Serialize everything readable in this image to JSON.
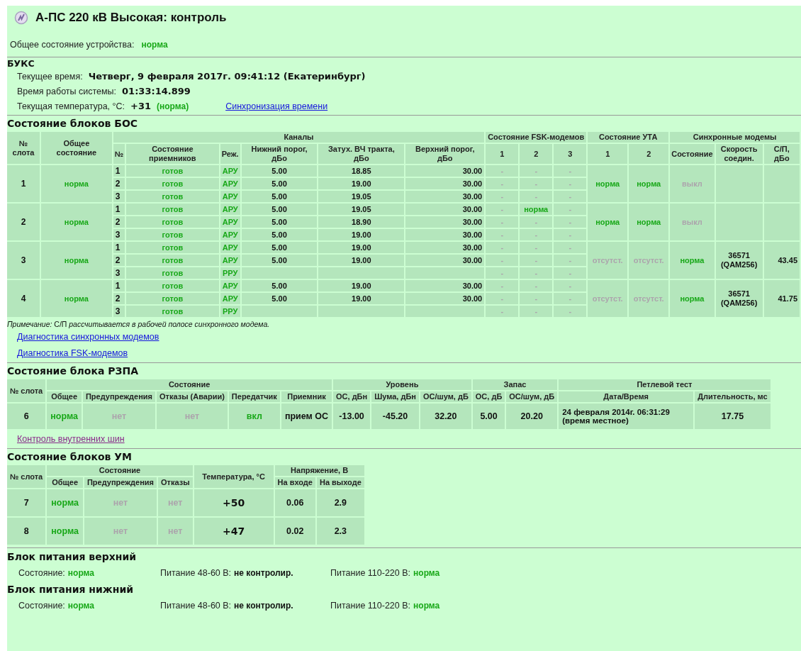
{
  "title": "А-ПС 220 кВ Высокая: контроль",
  "device_status": {
    "label": "Общее состояние устройства:",
    "value": {
      "text": "норма",
      "kind": "ok"
    }
  },
  "buks": {
    "heading": "БУКС",
    "fields": [
      {
        "label": "Текущее время:",
        "value": "Четверг, 9 февраля 2017г. 09:41:12 (Екатеринбург)"
      },
      {
        "label": "Время работы системы:",
        "value": "01:33:14.899"
      },
      {
        "label": "Текущая температура, °C:",
        "value": "+31",
        "note": {
          "text": "(норма)",
          "kind": "ok"
        },
        "link": "Синхронизация времени"
      }
    ]
  },
  "bos": {
    "heading": "Состояние блоков БОС",
    "column_groups": [
      {
        "label": "№ слота"
      },
      {
        "label": "Общее состояние"
      },
      {
        "label": "Каналы",
        "children": [
          "№",
          "Состояние приемников",
          "Реж.",
          "Нижний порог, дБо",
          "Затух. ВЧ тракта, дБо",
          "Верхний порог, дБо"
        ]
      },
      {
        "label": "Состояние FSK-модемов",
        "children": [
          "1",
          "2",
          "3"
        ]
      },
      {
        "label": "Состояние УТА",
        "children": [
          "1",
          "2"
        ]
      },
      {
        "label": "Синхронные модемы",
        "children": [
          "Состояние",
          "Скорость соедин.",
          "С/П, дБо"
        ]
      }
    ],
    "slots": [
      {
        "slot": "1",
        "status": {
          "text": "норма",
          "kind": "ok"
        },
        "channels": [
          {
            "number": "1",
            "receiver": {
              "text": "готов",
              "kind": "ok"
            },
            "mode": {
              "text": "АРУ",
              "kind": "ok"
            },
            "low": "5.00",
            "attenuation": "18.85",
            "high": "30.00",
            "fsk": [
              {
                "text": "-",
                "kind": "off"
              },
              {
                "text": "-",
                "kind": "off"
              },
              {
                "text": "-",
                "kind": "off"
              }
            ]
          },
          {
            "number": "2",
            "receiver": {
              "text": "готов",
              "kind": "ok"
            },
            "mode": {
              "text": "АРУ",
              "kind": "ok"
            },
            "low": "5.00",
            "attenuation": "19.00",
            "high": "30.00",
            "fsk": [
              {
                "text": "-",
                "kind": "off"
              },
              {
                "text": "-",
                "kind": "off"
              },
              {
                "text": "-",
                "kind": "off"
              }
            ]
          },
          {
            "number": "3",
            "receiver": {
              "text": "готов",
              "kind": "ok"
            },
            "mode": {
              "text": "АРУ",
              "kind": "ok"
            },
            "low": "5.00",
            "attenuation": "19.05",
            "high": "30.00",
            "fsk": [
              {
                "text": "-",
                "kind": "off"
              },
              {
                "text": "-",
                "kind": "off"
              },
              {
                "text": "-",
                "kind": "off"
              }
            ]
          }
        ],
        "uta": [
          {
            "text": "норма",
            "kind": "ok"
          },
          {
            "text": "норма",
            "kind": "ok"
          }
        ],
        "sync_state": {
          "text": "выкл",
          "kind": "off"
        }
      },
      {
        "slot": "2",
        "status": {
          "text": "норма",
          "kind": "ok"
        },
        "channels": [
          {
            "number": "1",
            "receiver": {
              "text": "готов",
              "kind": "ok"
            },
            "mode": {
              "text": "АРУ",
              "kind": "ok"
            },
            "low": "5.00",
            "attenuation": "19.05",
            "high": "30.00",
            "fsk": [
              {
                "text": "-",
                "kind": "off"
              },
              {
                "text": "норма",
                "kind": "ok"
              },
              {
                "text": "-",
                "kind": "off"
              }
            ]
          },
          {
            "number": "2",
            "receiver": {
              "text": "готов",
              "kind": "ok"
            },
            "mode": {
              "text": "АРУ",
              "kind": "ok"
            },
            "low": "5.00",
            "attenuation": "18.90",
            "high": "30.00",
            "fsk": [
              {
                "text": "-",
                "kind": "off"
              },
              {
                "text": "-",
                "kind": "off"
              },
              {
                "text": "-",
                "kind": "off"
              }
            ]
          },
          {
            "number": "3",
            "receiver": {
              "text": "готов",
              "kind": "ok"
            },
            "mode": {
              "text": "АРУ",
              "kind": "ok"
            },
            "low": "5.00",
            "attenuation": "19.00",
            "high": "30.00",
            "fsk": [
              {
                "text": "-",
                "kind": "off"
              },
              {
                "text": "-",
                "kind": "off"
              },
              {
                "text": "-",
                "kind": "off"
              }
            ]
          }
        ],
        "uta": [
          {
            "text": "норма",
            "kind": "ok"
          },
          {
            "text": "норма",
            "kind": "ok"
          }
        ],
        "sync_state": {
          "text": "выкл",
          "kind": "off"
        }
      },
      {
        "slot": "3",
        "status": {
          "text": "норма",
          "kind": "ok"
        },
        "channels": [
          {
            "number": "1",
            "receiver": {
              "text": "готов",
              "kind": "ok"
            },
            "mode": {
              "text": "АРУ",
              "kind": "ok"
            },
            "low": "5.00",
            "attenuation": "19.00",
            "high": "30.00",
            "fsk": [
              {
                "text": "-",
                "kind": "off"
              },
              {
                "text": "-",
                "kind": "off"
              },
              {
                "text": "-",
                "kind": "off"
              }
            ]
          },
          {
            "number": "2",
            "receiver": {
              "text": "готов",
              "kind": "ok"
            },
            "mode": {
              "text": "АРУ",
              "kind": "ok"
            },
            "low": "5.00",
            "attenuation": "19.00",
            "high": "30.00",
            "fsk": [
              {
                "text": "-",
                "kind": "off"
              },
              {
                "text": "-",
                "kind": "off"
              },
              {
                "text": "-",
                "kind": "off"
              }
            ]
          },
          {
            "number": "3",
            "receiver": {
              "text": "готов",
              "kind": "ok"
            },
            "mode": {
              "text": "РРУ",
              "kind": "ok"
            },
            "fsk": [
              {
                "text": "-",
                "kind": "off"
              },
              {
                "text": "-",
                "kind": "off"
              },
              {
                "text": "-",
                "kind": "off"
              }
            ]
          }
        ],
        "uta": [
          {
            "text": "отсутст.",
            "kind": "off"
          },
          {
            "text": "отсутст.",
            "kind": "off"
          }
        ],
        "sync_state": {
          "text": "норма",
          "kind": "ok"
        },
        "sync_speed": "36571 (QAM256)",
        "sync_snr": "43.45"
      },
      {
        "slot": "4",
        "status": {
          "text": "норма",
          "kind": "ok"
        },
        "channels": [
          {
            "number": "1",
            "receiver": {
              "text": "готов",
              "kind": "ok"
            },
            "mode": {
              "text": "АРУ",
              "kind": "ok"
            },
            "low": "5.00",
            "attenuation": "19.00",
            "high": "30.00",
            "fsk": [
              {
                "text": "-",
                "kind": "off"
              },
              {
                "text": "-",
                "kind": "off"
              },
              {
                "text": "-",
                "kind": "off"
              }
            ]
          },
          {
            "number": "2",
            "receiver": {
              "text": "готов",
              "kind": "ok"
            },
            "mode": {
              "text": "АРУ",
              "kind": "ok"
            },
            "low": "5.00",
            "attenuation": "19.00",
            "high": "30.00",
            "fsk": [
              {
                "text": "-",
                "kind": "off"
              },
              {
                "text": "-",
                "kind": "off"
              },
              {
                "text": "-",
                "kind": "off"
              }
            ]
          },
          {
            "number": "3",
            "receiver": {
              "text": "готов",
              "kind": "ok"
            },
            "mode": {
              "text": "РРУ",
              "kind": "ok"
            },
            "fsk": [
              {
                "text": "-",
                "kind": "off"
              },
              {
                "text": "-",
                "kind": "off"
              },
              {
                "text": "-",
                "kind": "off"
              }
            ]
          }
        ],
        "uta": [
          {
            "text": "отсутст.",
            "kind": "off"
          },
          {
            "text": "отсутст.",
            "kind": "off"
          }
        ],
        "sync_state": {
          "text": "норма",
          "kind": "ok"
        },
        "sync_speed": "36571 (QAM256)",
        "sync_snr": "41.75"
      }
    ],
    "note": "*Примечание:* С/П *рассчитывается в рабочей полосе синхронного модема.*",
    "links": [
      "Диагностика синхронных модемов",
      "Диагностика FSK-модемов"
    ]
  },
  "rzpa": {
    "heading": "Состояние блока РЗПА",
    "column_groups": [
      {
        "label": "№ слота"
      },
      {
        "label": "Состояние",
        "children": [
          "Общее",
          "Предупреждения",
          "Отказы (Аварии)",
          "Передатчик",
          "Приемник"
        ]
      },
      {
        "label": "Уровень",
        "children": [
          "ОС, дБн",
          "Шума, дБн",
          "ОС/шум, дБ"
        ]
      },
      {
        "label": "Запас",
        "children": [
          "ОС, дБ",
          "ОС/шум, дБ"
        ]
      },
      {
        "label": "Петлевой тест",
        "children": [
          "Дата/Время",
          "Длительность, мс"
        ]
      }
    ],
    "rows": [
      [
        {
          "text": "6",
          "kind": "plain"
        },
        {
          "text": "норма",
          "kind": "ok"
        },
        {
          "text": "нет",
          "kind": "off"
        },
        {
          "text": "нет",
          "kind": "off"
        },
        {
          "text": "вкл",
          "kind": "ok"
        },
        {
          "text": "прием ОС",
          "kind": "plain"
        },
        {
          "text": "-13.00",
          "kind": "plain"
        },
        {
          "text": "-45.20",
          "kind": "plain"
        },
        {
          "text": "32.20",
          "kind": "plain"
        },
        {
          "text": "5.00",
          "kind": "plain"
        },
        {
          "text": "20.20",
          "kind": "plain"
        },
        {
          "text": "24 февраля 2014г. 06:31:29 (время местное)",
          "kind": "datetime"
        },
        {
          "text": "17.75",
          "kind": "plain"
        }
      ]
    ],
    "link": "Контроль внутренних шин"
  },
  "um": {
    "heading": "Состояние блоков УМ",
    "column_groups": [
      {
        "label": "№ слота"
      },
      {
        "label": "Состояние",
        "children": [
          "Общее",
          "Предупреждения",
          "Отказы"
        ]
      },
      {
        "label": "Температура, °C"
      },
      {
        "label": "Напряжение, В",
        "children": [
          "На входе",
          "На выходе"
        ]
      }
    ],
    "rows": [
      [
        {
          "text": "7",
          "kind": "plain"
        },
        {
          "text": "норма",
          "kind": "ok"
        },
        {
          "text": "нет",
          "kind": "off"
        },
        {
          "text": "нет",
          "kind": "off"
        },
        {
          "text": "+50",
          "kind": "temperature"
        },
        {
          "text": "0.06",
          "kind": "plain"
        },
        {
          "text": "2.9",
          "kind": "plain"
        }
      ],
      [
        {
          "text": "8",
          "kind": "plain"
        },
        {
          "text": "норма",
          "kind": "ok"
        },
        {
          "text": "нет",
          "kind": "off"
        },
        {
          "text": "нет",
          "kind": "off"
        },
        {
          "text": "+47",
          "kind": "temperature"
        },
        {
          "text": "0.02",
          "kind": "plain"
        },
        {
          "text": "2.3",
          "kind": "plain"
        }
      ]
    ]
  },
  "power_blocks": [
    {
      "heading": "Блок питания верхний",
      "items": [
        {
          "label": "Состояние:",
          "value": {
            "text": "норма",
            "kind": "ok"
          }
        },
        {
          "label": "Питание 48-60 В:",
          "value": {
            "text": "не контролир.",
            "kind": "plain"
          }
        },
        {
          "label": "Питание 110-220 В:",
          "value": {
            "text": "норма",
            "kind": "ok"
          }
        }
      ]
    },
    {
      "heading": "Блок питания нижний",
      "items": [
        {
          "label": "Состояние:",
          "value": {
            "text": "норма",
            "kind": "ok"
          }
        },
        {
          "label": "Питание 48-60 В:",
          "value": {
            "text": "не контролир.",
            "kind": "plain"
          }
        },
        {
          "label": "Питание 110-220 В:",
          "value": {
            "text": "норма",
            "kind": "ok"
          }
        }
      ]
    }
  ]
}
